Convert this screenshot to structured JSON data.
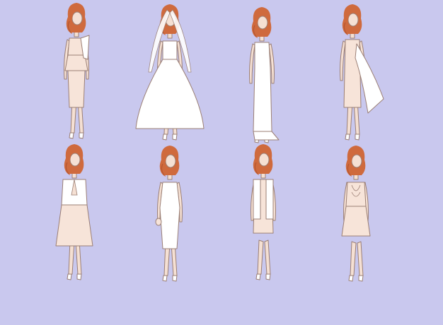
{
  "colors": {
    "background": "#c9c8ee",
    "hair": "#cf6a3d",
    "hair_shadow": "#b55530",
    "skin": "#f5e0d3",
    "dress_white": "#ffffff",
    "dress_blush": "#f7e4d9",
    "outline": "#9b7f75"
  },
  "figures": [
    {
      "id": "peplum-set",
      "gown": "peplum",
      "tone": "blush"
    },
    {
      "id": "ball-gown-veil",
      "gown": "ballgown",
      "tone": "white"
    },
    {
      "id": "column-gown",
      "gown": "column",
      "tone": "white"
    },
    {
      "id": "cape-dress",
      "gown": "cape",
      "tone": "blush"
    },
    {
      "id": "blazer-skirt",
      "gown": "blazer",
      "tone": "blush"
    },
    {
      "id": "strapless-sheath",
      "gown": "sheath",
      "tone": "white"
    },
    {
      "id": "vest-dress",
      "gown": "vest",
      "tone": "blush"
    },
    {
      "id": "corset-mini",
      "gown": "corset",
      "tone": "blush"
    }
  ]
}
